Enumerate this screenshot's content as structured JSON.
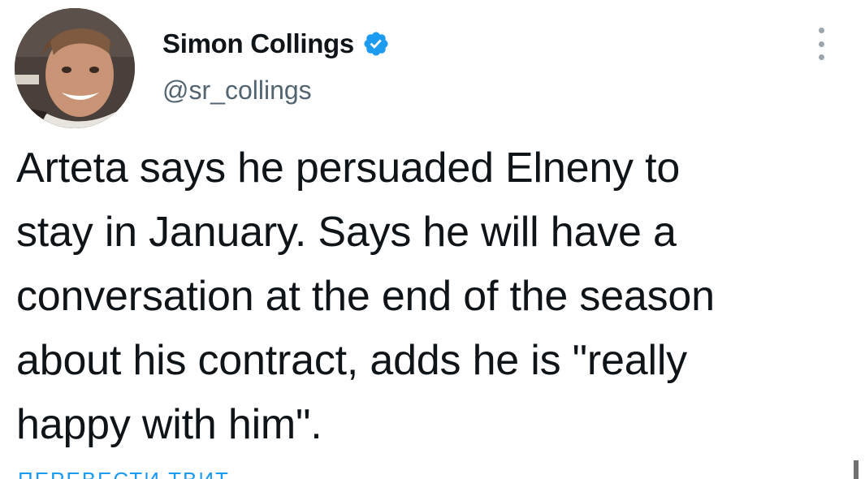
{
  "tweet": {
    "author": {
      "name": "Simon Collings",
      "handle": "@sr_collings",
      "verified": true,
      "avatar_icon": "profile-photo"
    },
    "more_icon": "more-options-vertical-icon",
    "text": "Arteta says he persuaded Elneny to\nstay in January. Says he will have a\nconversation at the end of the season\nabout his contract, adds he is \"really\nhappy with him\".",
    "translate_link": "ПЕРЕВЕСТИ ТВИТ"
  },
  "colors": {
    "text_primary": "#0f1419",
    "text_secondary": "#536471",
    "verified_badge": "#1d9bf0",
    "link": "#1d9bf0",
    "background": "#ffffff"
  }
}
